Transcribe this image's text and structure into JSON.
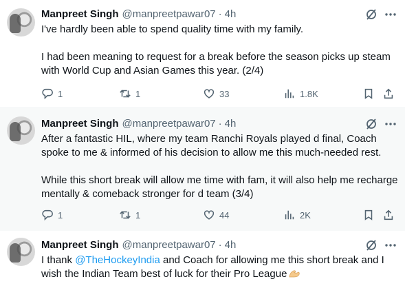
{
  "colors": {
    "accent": "#1d9bf0",
    "text": "#0f1419",
    "secondary": "#536471",
    "highlight_bg": "#f7f9f9"
  },
  "icons": [
    "grok-icon",
    "more-icon",
    "reply-icon",
    "retweet-icon",
    "like-icon",
    "views-icon",
    "bookmark-icon",
    "share-icon",
    "flexed-biceps-emoji"
  ],
  "tweets": [
    {
      "name": "Manpreet Singh",
      "handle": "@manpreetpawar07",
      "separator": "·",
      "time": "4h",
      "paragraphs": [
        "I've hardly been able to spend quality time with my family.",
        "I had been meaning to request for a break before the season picks up steam with World Cup and Asian Games this year. (2/4)"
      ],
      "stats": {
        "replies": "1",
        "retweets": "1",
        "likes": "33",
        "views": "1.8K"
      }
    },
    {
      "name": "Manpreet Singh",
      "handle": "@manpreetpawar07",
      "separator": "·",
      "time": "4h",
      "paragraphs": [
        "After a fantastic HIL, where my team Ranchi Royals played d final, Coach spoke to me & informed of his decision to allow me this much-needed rest.",
        "While this short break will allow me time with fam, it will also help me recharge mentally & comeback stronger for d team (3/4)"
      ],
      "stats": {
        "replies": "1",
        "retweets": "1",
        "likes": "44",
        "views": "2K"
      }
    },
    {
      "name": "Manpreet Singh",
      "handle": "@manpreetpawar07",
      "separator": "·",
      "time": "4h",
      "text_before": "I thank ",
      "mention": "@TheHockeyIndia",
      "text_after": " and Coach for allowing me this short break and I wish the Indian Team best of luck for their Pro League"
    }
  ]
}
